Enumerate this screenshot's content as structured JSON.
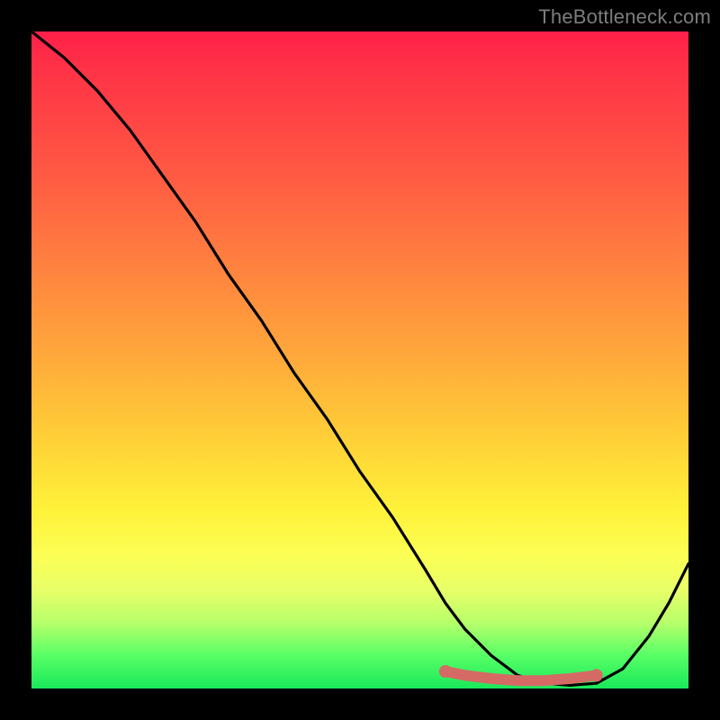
{
  "watermark": "TheBottleneck.com",
  "chart_data": {
    "type": "line",
    "title": "",
    "xlabel": "",
    "ylabel": "",
    "xlim": [
      0,
      100
    ],
    "ylim": [
      0,
      100
    ],
    "series": [
      {
        "name": "bottleneck-curve",
        "x": [
          0,
          5,
          10,
          15,
          20,
          25,
          30,
          35,
          40,
          45,
          50,
          55,
          60,
          63,
          66,
          70,
          74,
          78,
          82,
          86,
          90,
          94,
          97,
          100
        ],
        "y": [
          100,
          96,
          91,
          85,
          78,
          71,
          63,
          56,
          48,
          41,
          33,
          26,
          18,
          13,
          9,
          5,
          2,
          0.8,
          0.5,
          0.8,
          3,
          8,
          13,
          19
        ]
      },
      {
        "name": "highlight-band",
        "x": [
          63,
          66,
          70,
          74,
          78,
          82,
          86
        ],
        "y": [
          2.6,
          2.0,
          1.5,
          1.2,
          1.2,
          1.5,
          2.0
        ]
      }
    ],
    "colors": {
      "curve": "#000000",
      "highlight": "#d56a65"
    }
  }
}
